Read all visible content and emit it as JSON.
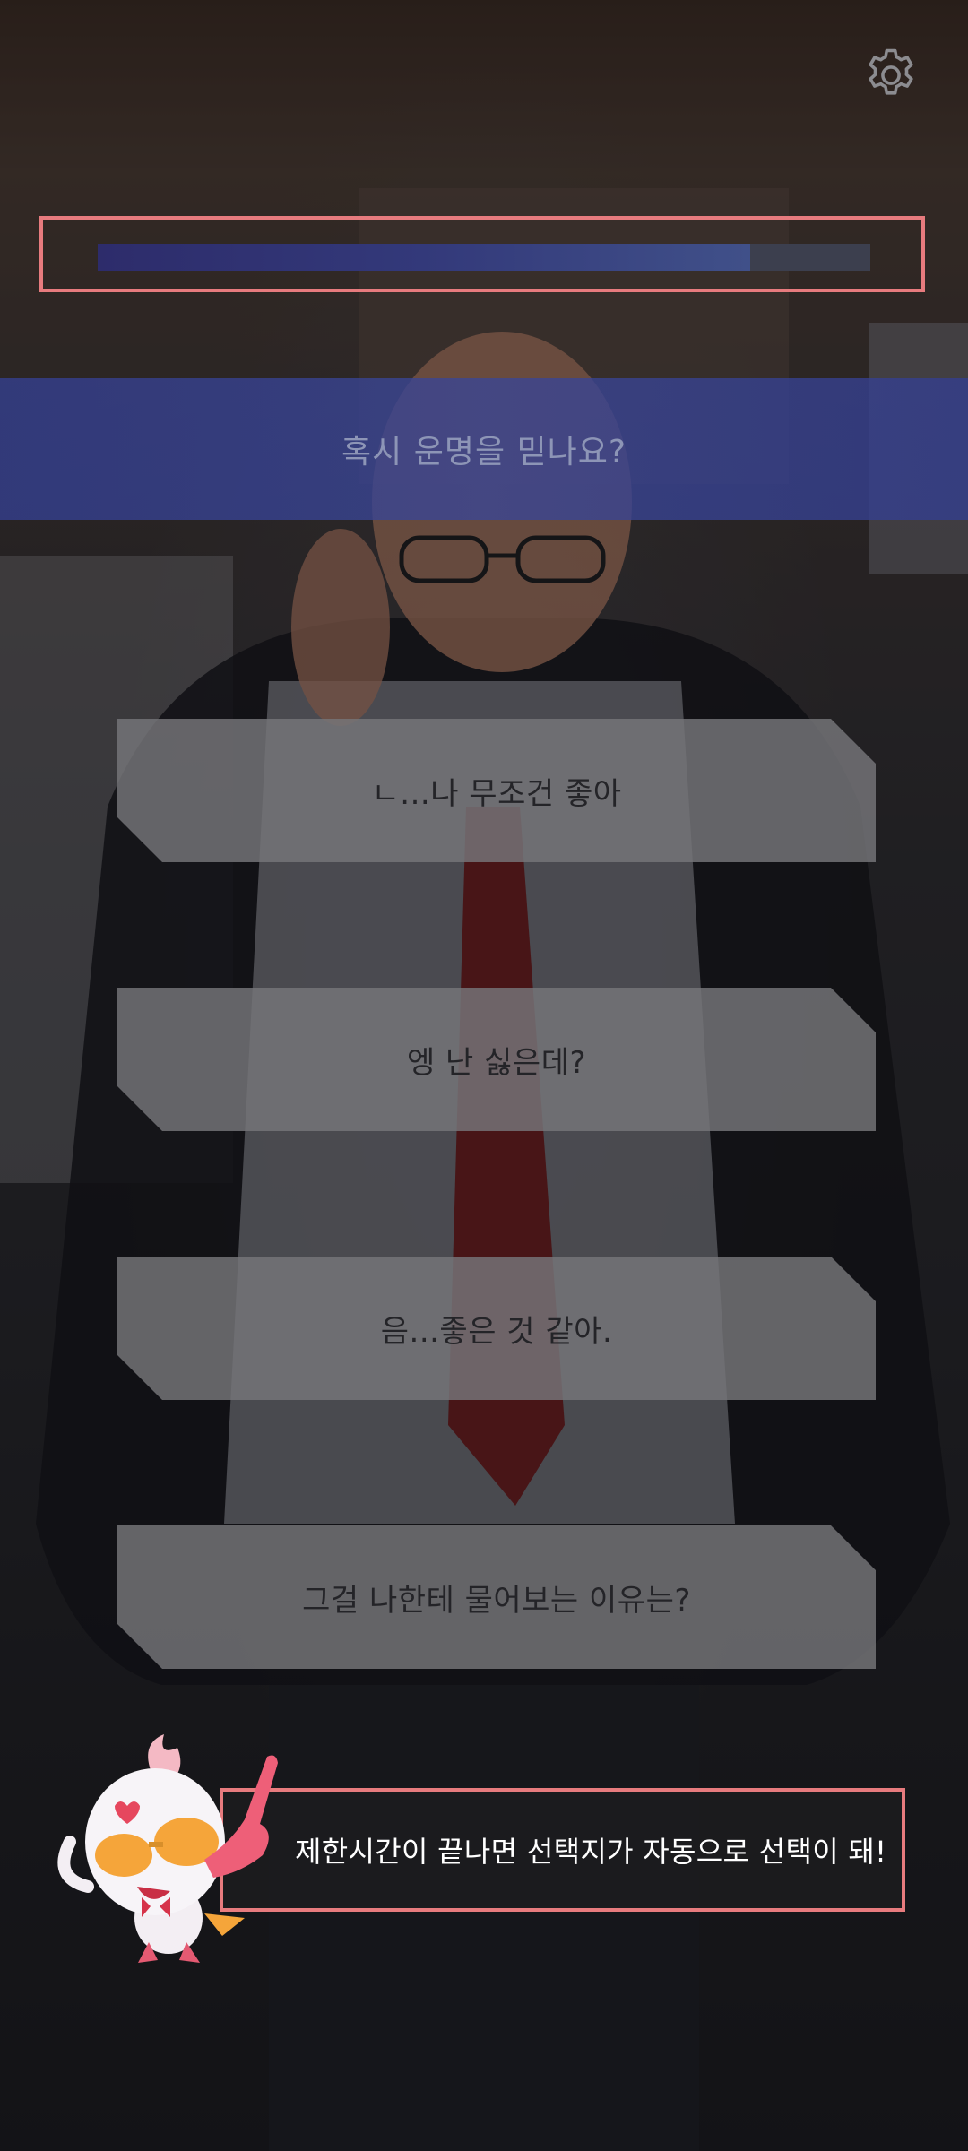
{
  "question": {
    "text": "혹시 운명을 믿나요?"
  },
  "timer": {
    "remaining_fraction": 0.845
  },
  "choices": [
    {
      "label": "ㄴ...나 무조건 좋아"
    },
    {
      "label": "엥 난 싫은데?"
    },
    {
      "label": "음...좋은 것 같아."
    },
    {
      "label": "그걸 나한테 물어보는 이유는?"
    }
  ],
  "hint": {
    "text": "제한시간이 끝나면 선택지가 자동으로 선택이 돼!"
  },
  "icons": {
    "settings": "gear-icon",
    "mascot": "mascot-character-icon"
  },
  "colors": {
    "accent_border": "#e77b7e",
    "question_banner": "#3a4696",
    "timer_fill": "#33397a",
    "choice_bg": "#76767a"
  }
}
